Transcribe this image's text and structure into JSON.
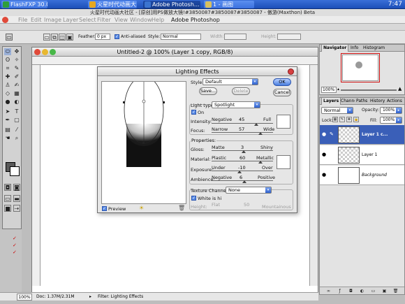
{
  "taskbar": {
    "tasks": [
      {
        "label": "FlashFXP 30.00...",
        "icon_color": "#2f9e3c"
      },
      {
        "label": "火星时代动画大...",
        "icon_color": "#e6a820"
      },
      {
        "label": "Adobe Photosh...",
        "icon_color": "#3b74d0"
      },
      {
        "label": "1 - 画图",
        "icon_color": "#d8c060"
      }
    ],
    "clock": "7:47"
  },
  "browser_title": "火星时代动画大社区 - [原创]用PS做放大镜!#3850087#3850087#3850087 - 傲游(Maxthon) Beta",
  "menubar": {
    "items": [
      "File",
      "Edit",
      "Image",
      "Layer",
      "Select",
      "Filter",
      "View",
      "Window",
      "Help"
    ],
    "app_title": "Adobe Photoshop"
  },
  "options_bar": {
    "feather_label": "Feather:",
    "feather_value": "0 px",
    "antialiased_label": "Anti-aliased",
    "style_label": "Style:",
    "style_value": "Normal",
    "width_label": "Width:",
    "height_label": "Height:"
  },
  "document": {
    "title": "Untitled-2 @ 100% (Layer 1 copy, RGB/8)",
    "status_zoom": "100%",
    "status_doc": "Doc: 1.37M/2.31M",
    "status_filter": "Filter: Lighting Effects"
  },
  "dialog": {
    "title": "Lighting Effects",
    "style_label": "Style:",
    "style_value": "Default",
    "save_label": "Save...",
    "delete_label": "Delete",
    "ok_label": "OK",
    "cancel_label": "Cancel",
    "light_type_label": "Light type:",
    "light_type_value": "Spotlight",
    "on_label": "On",
    "intensity": {
      "label": "Intensity:",
      "min": "Negative",
      "max": "Full",
      "value": "45",
      "level": 0.73
    },
    "focus": {
      "label": "Focus:",
      "min": "Narrow",
      "max": "Wide",
      "value": "57",
      "level": 0.79
    },
    "properties_title": "Properties:",
    "gloss": {
      "label": "Gloss:",
      "min": "Matte",
      "max": "Shiny",
      "value": "3",
      "level": 0.52
    },
    "material": {
      "label": "Material:",
      "min": "Plastic",
      "max": "Metallic",
      "value": "60",
      "level": 0.8
    },
    "exposure": {
      "label": "Exposure:",
      "min": "Under",
      "max": "Over",
      "value": "-10",
      "level": 0.45
    },
    "ambience": {
      "label": "Ambience:",
      "min": "Negative",
      "max": "Positive",
      "value": "6",
      "level": 0.53
    },
    "texture_label": "Texture Channel:",
    "texture_value": "None",
    "white_is_high_label": "White is hi",
    "height_label": "Height:",
    "height_min": "Flat",
    "height_max": "Mountainous",
    "height_value": "50",
    "preview_label": "Preview"
  },
  "navigator": {
    "tabs": [
      "Navigator",
      "Info",
      "Histogram"
    ],
    "zoom": "100%"
  },
  "layers": {
    "tabs": [
      "Layers",
      "Channels",
      "Paths",
      "History",
      "Actions"
    ],
    "blend_mode": "Normal",
    "opacity_label": "Opacity:",
    "opacity_value": "100%",
    "lock_label": "Lock:",
    "fill_label": "Fill:",
    "fill_value": "100%",
    "items": [
      {
        "name": "Layer 1 c...",
        "selected": true
      },
      {
        "name": "Layer 1",
        "selected": false
      },
      {
        "name": "Background",
        "selected": false
      }
    ]
  }
}
